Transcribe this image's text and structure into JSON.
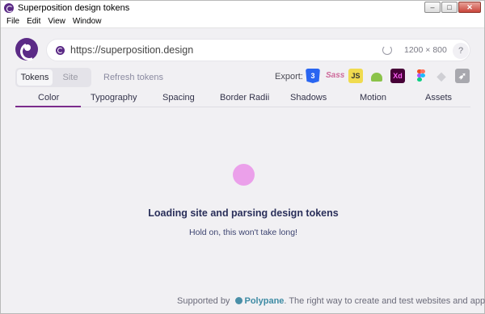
{
  "window": {
    "title": "Superposition design tokens"
  },
  "menu": {
    "items": [
      "File",
      "Edit",
      "View",
      "Window"
    ]
  },
  "url_bar": {
    "url": "https://superposition.design",
    "dimensions": "1200 × 800",
    "help": "?"
  },
  "view_toggle": {
    "tokens": "Tokens",
    "site": "Site"
  },
  "refresh_label": "Refresh tokens",
  "export": {
    "label": "Export:",
    "icons": [
      "css3-icon",
      "sass-icon",
      "javascript-icon",
      "android-icon",
      "adobe-xd-icon",
      "figma-icon",
      "sketch-icon",
      "swift-icon"
    ],
    "js_text": "JS",
    "xd_text": "Xd",
    "sass_text": "Sass"
  },
  "tabs": [
    "Color",
    "Typography",
    "Spacing",
    "Border Radii",
    "Shadows",
    "Motion",
    "Assets"
  ],
  "active_tab": "Color",
  "loading": {
    "title": "Loading site and parsing design tokens",
    "subtitle": "Hold on, this won't take long!"
  },
  "footer": {
    "prefix": "Supported by",
    "brand": "Polypane",
    "suffix": ". The right way to create and test websites and apps"
  },
  "colors": {
    "brand": "#5b2a86",
    "accent": "#7b2b8c",
    "loader": "#eba0ea"
  }
}
